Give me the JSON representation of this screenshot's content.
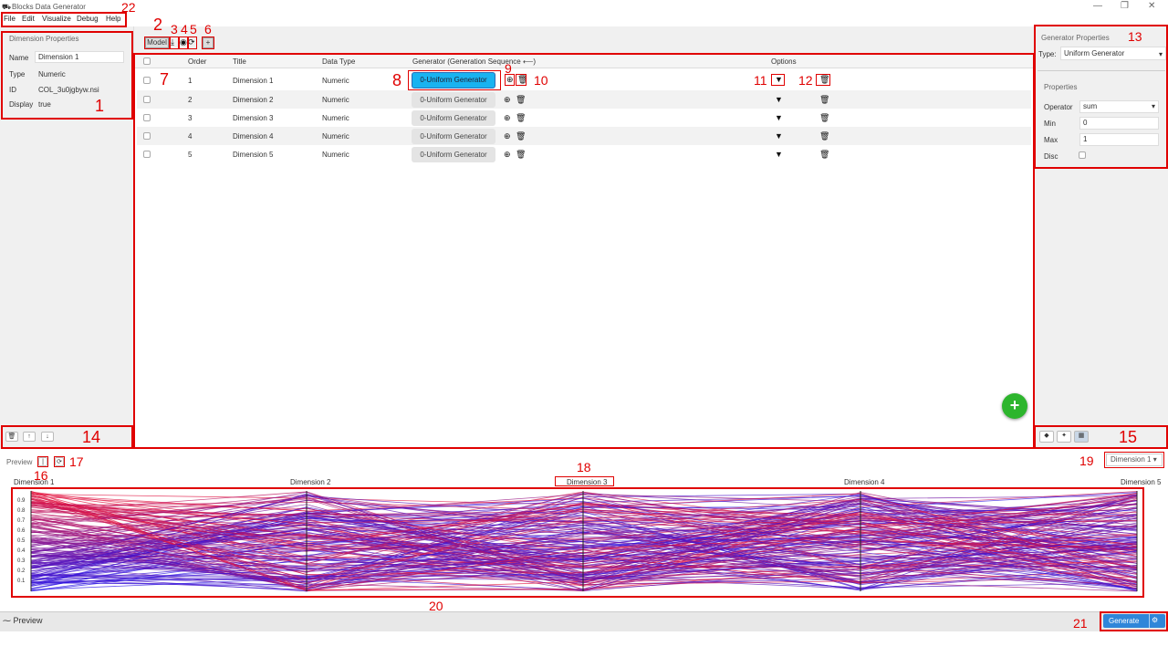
{
  "window": {
    "title": "Blocks Data Generator",
    "controls": [
      "—",
      "❐",
      "✕"
    ]
  },
  "menu": {
    "items": [
      "File",
      "Edit",
      "Visualize",
      "Debug",
      "Help"
    ]
  },
  "dimension_properties": {
    "heading": "Dimension Properties",
    "name_label": "Name",
    "name_value": "Dimension 1",
    "type_label": "Type",
    "type_value": "Numeric",
    "id_label": "ID",
    "id_value": "COL_3u0jgbyw.nsi",
    "display_label": "Display",
    "display_value": "true"
  },
  "toolbar": {
    "model_label": "Model",
    "add_label": "+"
  },
  "table": {
    "headers": {
      "order": "Order",
      "title": "Title",
      "data_type": "Data Type",
      "generator": "Generator (Generation Sequence ⟵)",
      "options": "Options"
    },
    "rows": [
      {
        "order": "1",
        "title": "Dimension 1",
        "data_type": "Numeric",
        "generator": "0-Uniform Generator"
      },
      {
        "order": "2",
        "title": "Dimension 2",
        "data_type": "Numeric",
        "generator": "0-Uniform Generator"
      },
      {
        "order": "3",
        "title": "Dimension 3",
        "data_type": "Numeric",
        "generator": "0-Uniform Generator"
      },
      {
        "order": "4",
        "title": "Dimension 4",
        "data_type": "Numeric",
        "generator": "0-Uniform Generator"
      },
      {
        "order": "5",
        "title": "Dimension 5",
        "data_type": "Numeric",
        "generator": "0-Uniform Generator"
      }
    ]
  },
  "generator_properties": {
    "heading": "Generator Properties",
    "type_label": "Type:",
    "type_value": "Uniform Generator",
    "properties_heading": "Properties",
    "operator_label": "Operator",
    "operator_value": "sum",
    "min_label": "Min",
    "min_value": "0",
    "max_label": "Max",
    "max_value": "1",
    "disc_label": "Disc"
  },
  "preview": {
    "label": "Preview",
    "dimension_select": "Dimension 1 ▾",
    "axes": [
      "Dimension 1",
      "Dimension 2",
      "Dimension 3",
      "Dimension 4",
      "Dimension 5"
    ],
    "ticks": [
      "0.9",
      "0.8",
      "0.7",
      "0.6",
      "0.5",
      "0.4",
      "0.3",
      "0.2",
      "0.1"
    ]
  },
  "bottom": {
    "preview_tab": "Preview",
    "generate_label": "Generate"
  },
  "annotations": [
    "1",
    "2",
    "3",
    "4",
    "5",
    "6",
    "7",
    "8",
    "9",
    "10",
    "11",
    "12",
    "13",
    "14",
    "15",
    "16",
    "17",
    "18",
    "19",
    "20",
    "21",
    "22"
  ],
  "colors": {
    "accent": "#19b3f0",
    "generate": "#2f86d9",
    "annotation": "#e00000",
    "line_red": "#e0203a",
    "line_blue": "#3020e0"
  }
}
